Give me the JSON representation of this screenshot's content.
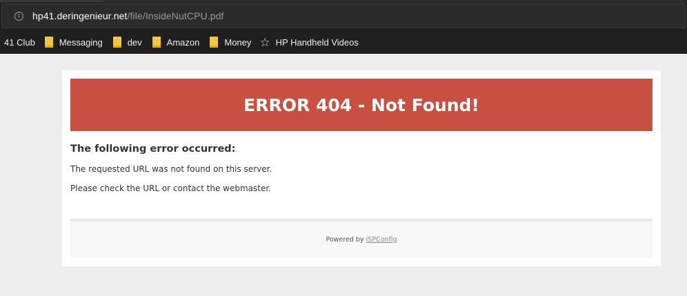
{
  "browser": {
    "url_host": "hp41.deringenieur.net",
    "url_path": "/file/InsideNutCPU.pdf",
    "bookmarks": [
      {
        "label": "41 Club",
        "icon": "none"
      },
      {
        "label": "Messaging",
        "icon": "folder-icon"
      },
      {
        "label": "dev",
        "icon": "folder-icon"
      },
      {
        "label": "Amazon",
        "icon": "folder-icon"
      },
      {
        "label": "Money",
        "icon": "folder-icon"
      },
      {
        "label": "HP Handheld Videos",
        "icon": "star-icon"
      }
    ]
  },
  "page": {
    "banner_title": "ERROR 404 - Not Found!",
    "heading": "The following error occurred:",
    "message_1": "The requested URL was not found on this server.",
    "message_2": "Please check the URL or contact the webmaster.",
    "footer_prefix": "Powered by",
    "footer_link": "ISPConfig"
  },
  "colors": {
    "banner": "#c75042",
    "chrome": "#1f1f1f",
    "page_bg": "#eeeeee"
  }
}
